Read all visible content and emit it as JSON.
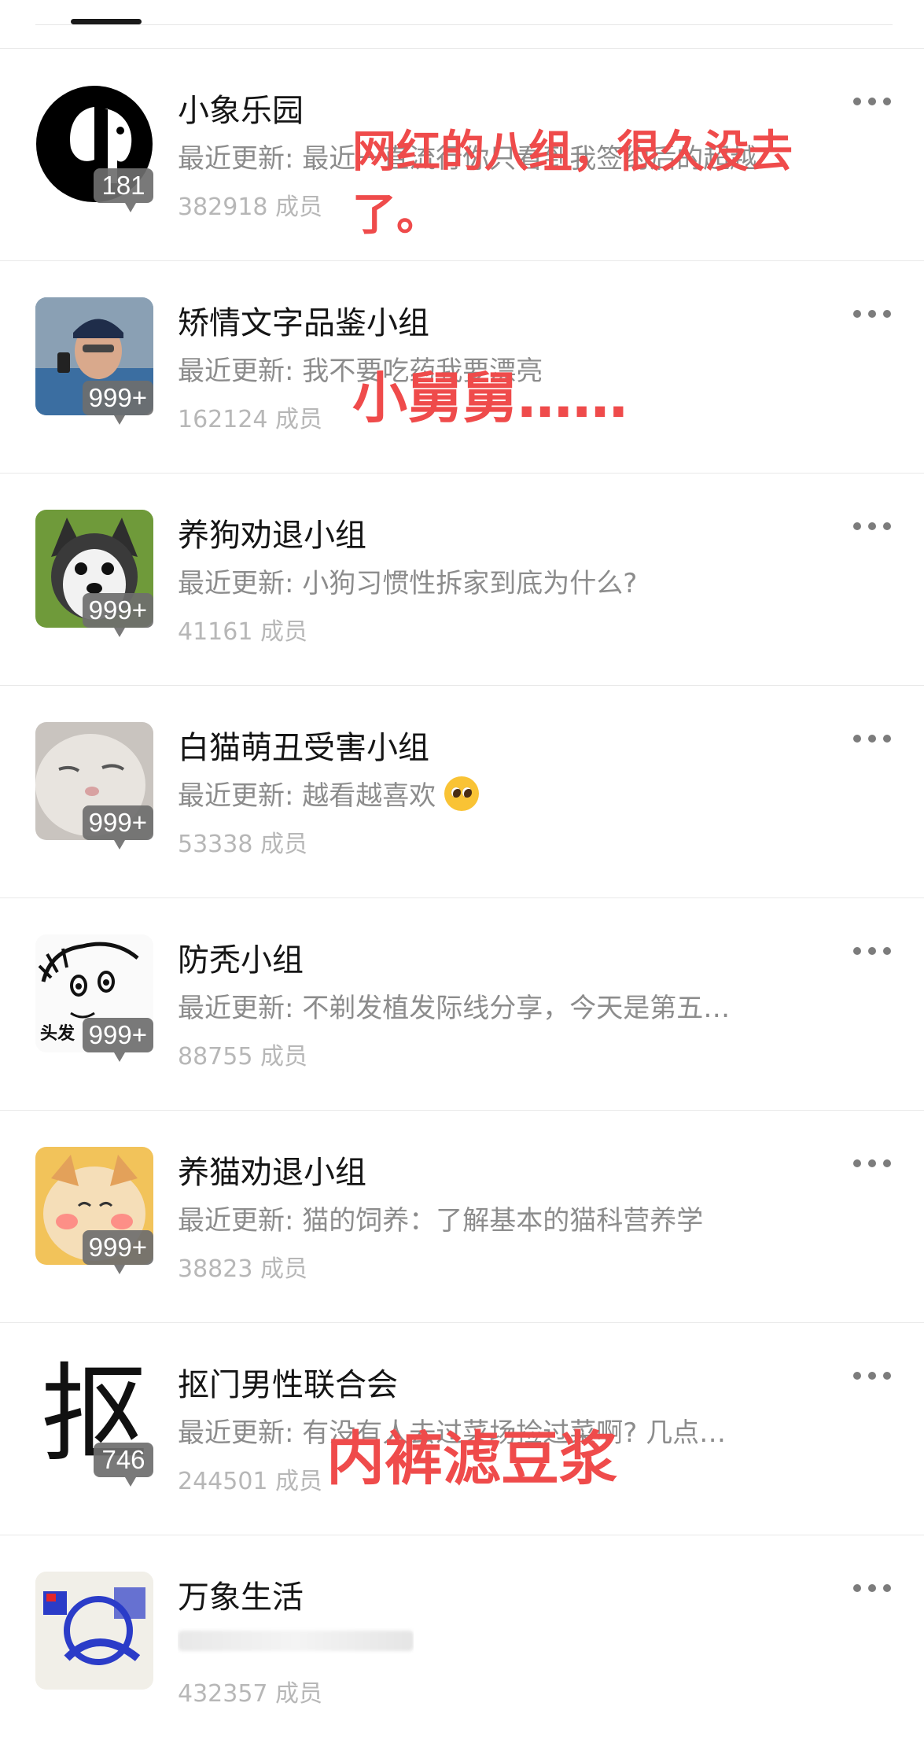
{
  "groups": [
    {
      "title": "小象乐园",
      "update": "最近更新: 最近一直流行你只看到我签约后的超越",
      "members": "382918 成员",
      "badge": "181"
    },
    {
      "title": "矫情文字品鉴小组",
      "update": "最近更新: 我不要吃药我要漂亮",
      "members": "162124 成员",
      "badge": "999+"
    },
    {
      "title": "养狗劝退小组",
      "update": "最近更新: 小狗习惯性拆家到底为什么?",
      "members": "41161 成员",
      "badge": "999+"
    },
    {
      "title": "白猫萌丑受害小组",
      "update": "最近更新: 越看越喜欢",
      "members": "53338 成员",
      "badge": "999+"
    },
    {
      "title": "防秃小组",
      "update": "最近更新: 不剃发植发际线分享，今天是第五…",
      "members": "88755 成员",
      "badge": "999+"
    },
    {
      "title": "养猫劝退小组",
      "update": "最近更新: 猫的饲养：了解基本的猫科营养学",
      "members": "38823 成员",
      "badge": "999+"
    },
    {
      "title": "抠门男性联合会",
      "update": "最近更新: 有没有人去过菜场捡过菜啊? 几点…",
      "members": "244501 成员",
      "badge": "746"
    },
    {
      "title": "万象生活",
      "update": "",
      "members": "432357 成员",
      "badge": ""
    }
  ],
  "avatars": {
    "avatar_text_kou": "抠",
    "avatar_text_toufa": "头发"
  },
  "annotations": {
    "a1": "网红的八组，很久没去",
    "a1b": "了。",
    "a2": "小舅舅……",
    "a3": "内裤滤豆浆"
  },
  "colors": {
    "annotation": "#ef4b4b",
    "badge": "#6e6e6e"
  }
}
